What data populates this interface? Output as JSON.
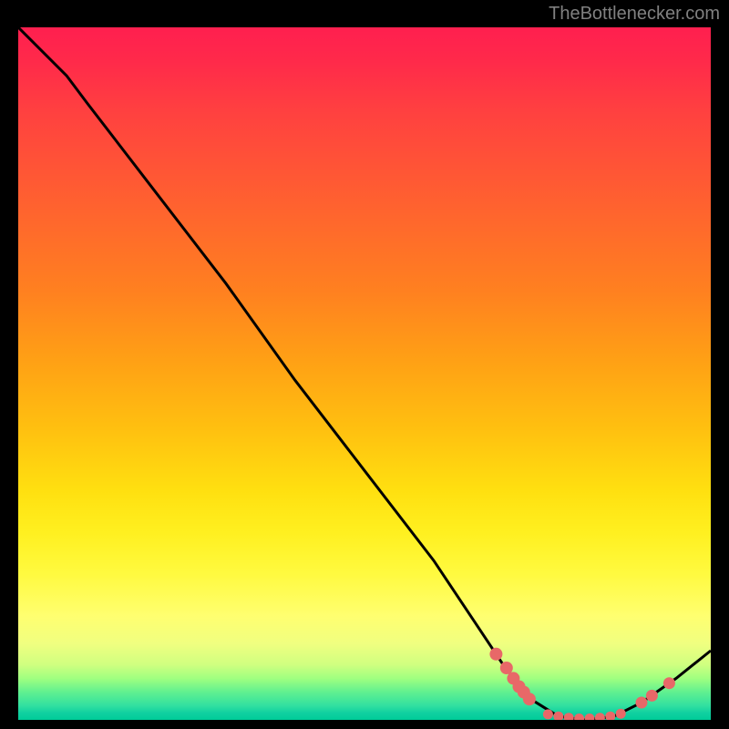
{
  "attribution": "TheBottlenecker.com",
  "chart_data": {
    "type": "line",
    "title": "",
    "xlabel": "",
    "ylabel": "",
    "x_range": [
      0,
      100
    ],
    "y_range": [
      0,
      100
    ],
    "curve_points": [
      {
        "x": 0,
        "y": 100
      },
      {
        "x": 7,
        "y": 93
      },
      {
        "x": 10,
        "y": 89
      },
      {
        "x": 20,
        "y": 76
      },
      {
        "x": 30,
        "y": 63
      },
      {
        "x": 40,
        "y": 49
      },
      {
        "x": 50,
        "y": 36
      },
      {
        "x": 60,
        "y": 23
      },
      {
        "x": 66,
        "y": 14
      },
      {
        "x": 70,
        "y": 8
      },
      {
        "x": 74,
        "y": 3
      },
      {
        "x": 78,
        "y": 0.5
      },
      {
        "x": 82,
        "y": 0
      },
      {
        "x": 86,
        "y": 0.5
      },
      {
        "x": 90,
        "y": 2.5
      },
      {
        "x": 95,
        "y": 6
      },
      {
        "x": 100,
        "y": 10
      }
    ],
    "markers_left": [
      {
        "x": 69,
        "y": 9.5
      },
      {
        "x": 70.5,
        "y": 7.5
      },
      {
        "x": 71.5,
        "y": 6
      },
      {
        "x": 72.3,
        "y": 4.8
      },
      {
        "x": 73,
        "y": 4
      },
      {
        "x": 73.8,
        "y": 3
      }
    ],
    "markers_bottom": [
      {
        "x": 76.5,
        "y": 0.8
      },
      {
        "x": 78,
        "y": 0.5
      },
      {
        "x": 79.5,
        "y": 0.3
      },
      {
        "x": 81,
        "y": 0.2
      },
      {
        "x": 82.5,
        "y": 0.2
      },
      {
        "x": 84,
        "y": 0.3
      },
      {
        "x": 85.5,
        "y": 0.5
      },
      {
        "x": 87,
        "y": 0.9
      }
    ],
    "markers_right": [
      {
        "x": 90,
        "y": 2.5
      },
      {
        "x": 91.5,
        "y": 3.5
      },
      {
        "x": 94,
        "y": 5.3
      }
    ],
    "marker_color": "#e86868",
    "gradient_stops": [
      {
        "pos": 0,
        "color": "#ff1f4f"
      },
      {
        "pos": 50,
        "color": "#ffc010"
      },
      {
        "pos": 85,
        "color": "#ffff70"
      },
      {
        "pos": 100,
        "color": "#00cc99"
      }
    ]
  }
}
